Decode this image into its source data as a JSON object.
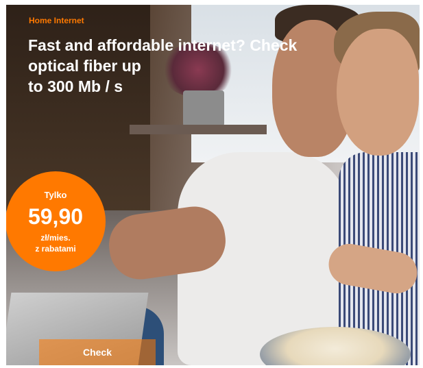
{
  "ad": {
    "eyebrow": "Home Internet",
    "headline_lines": [
      "Fast and affordable internet? Check",
      "optical fiber up",
      "to 300 Mb / s"
    ],
    "price": {
      "prefix": "Tylko",
      "value": "59,90",
      "unit": "zł/mies.",
      "note": "z rabatami"
    },
    "cta_label": "Check"
  },
  "colors": {
    "accent": "#ff7900",
    "text_light": "#ffffff"
  }
}
